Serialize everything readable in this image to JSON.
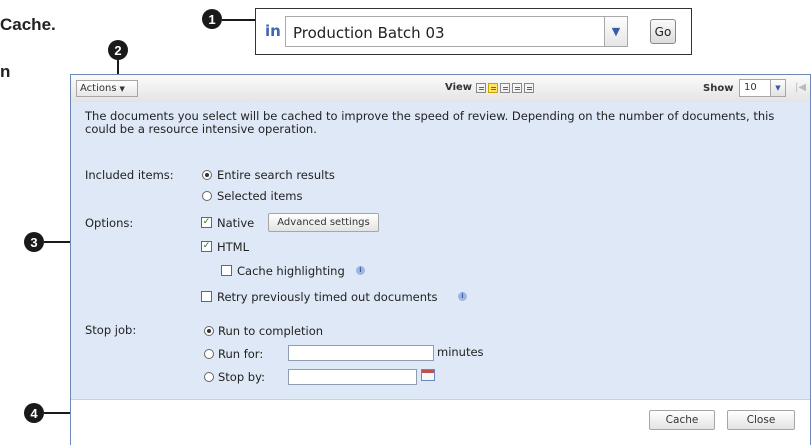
{
  "callout_text": {
    "fragment_top": "Cache.",
    "fragment_bottom": "n"
  },
  "callouts": [
    "1",
    "2",
    "3",
    "4"
  ],
  "search": {
    "scope_label": "in",
    "selected_value": "Production Batch 03",
    "go_label": "Go"
  },
  "toolbar": {
    "actions_label": "Actions",
    "view_label": "View",
    "show_label": "Show",
    "show_value": "10"
  },
  "dialog": {
    "description": "The documents you select will be cached to improve the speed of review. Depending on the number of documents, this could be a resource intensive operation.",
    "included_items": {
      "label": "Included items:",
      "options": [
        "Entire search results",
        "Selected items"
      ],
      "selected": "Entire search results"
    },
    "options": {
      "label": "Options:",
      "native_label": "Native",
      "native_checked": true,
      "advanced_settings_label": "Advanced settings",
      "html_label": "HTML",
      "html_checked": true,
      "cache_highlighting_label": "Cache highlighting",
      "cache_highlighting_checked": false,
      "retry_label": "Retry previously timed out documents",
      "retry_checked": false
    },
    "stop_job": {
      "label": "Stop job:",
      "run_to_completion_label": "Run to completion",
      "run_for_label": "Run for:",
      "run_for_value": "",
      "minutes_label": "minutes",
      "stop_by_label": "Stop by:",
      "stop_by_value": "",
      "selected": "Run to completion"
    },
    "buttons": {
      "cache_label": "Cache",
      "close_label": "Close"
    }
  },
  "colors": {
    "dialog_background": "#dfe8f6",
    "dialog_border": "#6d87b7",
    "scope_label": "#4066b6",
    "callout_badge": "#1a1a1a"
  }
}
